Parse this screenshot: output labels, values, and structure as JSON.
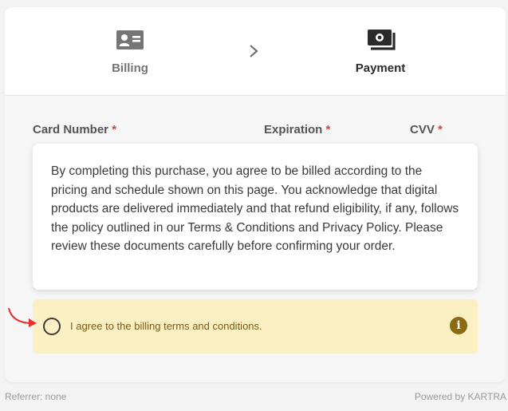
{
  "steps": {
    "billing": {
      "label": "Billing",
      "icon": "id-card-icon"
    },
    "separator_icon": "chevron-right-icon",
    "payment": {
      "label": "Payment",
      "icon": "cash-icon"
    }
  },
  "fields": {
    "card_number": {
      "label": "Card Number",
      "required": "*"
    },
    "expiration": {
      "label": "Expiration",
      "required": "*"
    },
    "cvv": {
      "label": "CVV",
      "required": "*"
    }
  },
  "terms": {
    "text": "By completing this purchase, you agree to be billed according to the pricing and schedule shown on this page. You acknowledge that digital products are delivered immediately and that refund eligibility, if any, follows the policy outlined in our Terms & Conditions and Privacy Policy. Please review these documents carefully before confirming your order."
  },
  "agreement": {
    "label": "I agree to the billing terms and conditions.",
    "checked": false,
    "info_icon": "info-icon"
  },
  "footer": {
    "referrer": "Referrer: none",
    "powered_by": "Powered by KARTRA"
  },
  "colors": {
    "required": "#e0413b",
    "agree_bg": "#fbefc4",
    "agree_text": "#7a5a14",
    "info": "#8a6a12",
    "arrow": "#e53030"
  }
}
